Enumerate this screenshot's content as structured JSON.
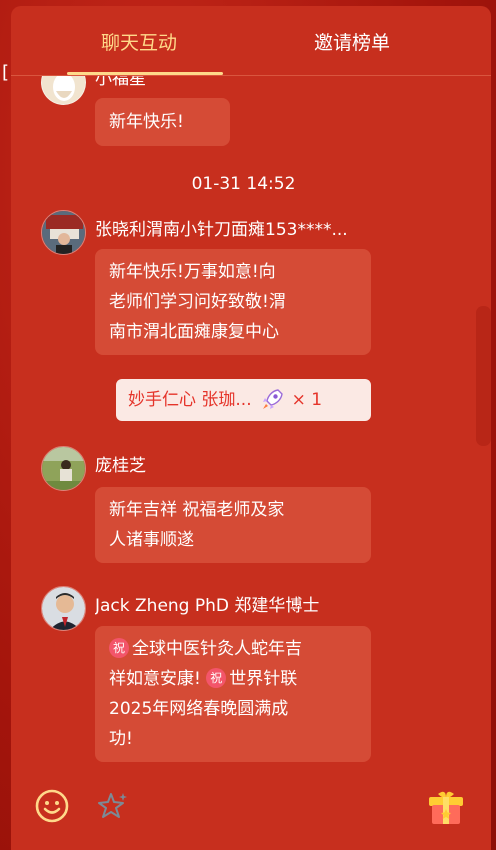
{
  "tabs": [
    {
      "label": "聊天互动",
      "active": true
    },
    {
      "label": "邀请榜单",
      "active": false
    }
  ],
  "messages": {
    "top_partial": {
      "username": "小福星",
      "text": "新年快乐!"
    },
    "timestamp": "01-31 14:52",
    "msg1": {
      "username": "张晓利渭南小针刀面瘫153****...",
      "lines": [
        "新年快乐!万事如意!向",
        "老师们学习问好致敬!渭",
        "南市渭北面瘫康复中心"
      ]
    },
    "gift": {
      "name": "妙手仁心 张珈...",
      "icon": "rocket-icon",
      "count": "× 1"
    },
    "msg2": {
      "username": "庞桂芝",
      "lines": [
        "新年吉祥  祝福老师及家",
        "人诸事顺遂"
      ]
    },
    "msg3": {
      "username": "Jack Zheng PhD 郑建华博士",
      "badge": "祝",
      "line1": "全球中医针灸人蛇年吉",
      "line2a": "祥如意安康!",
      "line2b": "世界针联",
      "line3": "2025年网络春晚圆满成",
      "line4": "功!"
    }
  },
  "colors": {
    "panel": "#c72f1e",
    "bubble": "#d54b36",
    "accent": "#ffd98a",
    "gift_text": "#e5342a"
  },
  "bottom": {
    "emoji_icon": "smile-icon",
    "like_icon": "sparkle-star-icon",
    "gift_icon": "gift-box-icon"
  }
}
